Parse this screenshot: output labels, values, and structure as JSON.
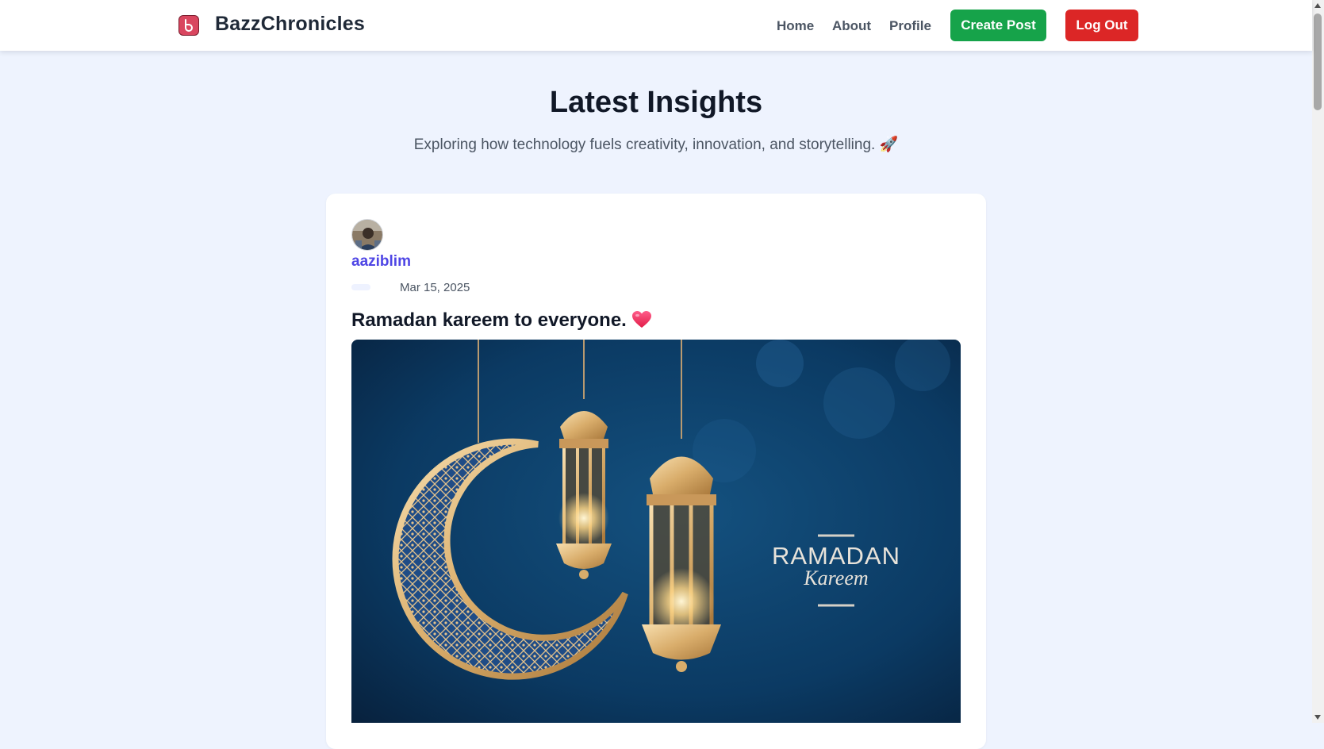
{
  "nav": {
    "brand": "BazzChronicles",
    "links": [
      "Home",
      "About",
      "Profile"
    ],
    "create_post": "Create Post",
    "logout": "Log Out"
  },
  "hero": {
    "title": "Latest Insights",
    "subtitle": "Exploring how technology fuels creativity, innovation, and storytelling. 🚀"
  },
  "post": {
    "author": "aaziblim",
    "date": "Mar 15, 2025",
    "title": "Ramadan kareem to everyone.",
    "title_icon": "heart-icon",
    "image": {
      "line1": "RAMADAN",
      "line2": "Kareem"
    }
  },
  "colors": {
    "background": "#eef3fe",
    "create_button": "#16a34a",
    "logout_button": "#dc2626",
    "author_link": "#4f46e5",
    "image_bg": "#0b3a63"
  }
}
